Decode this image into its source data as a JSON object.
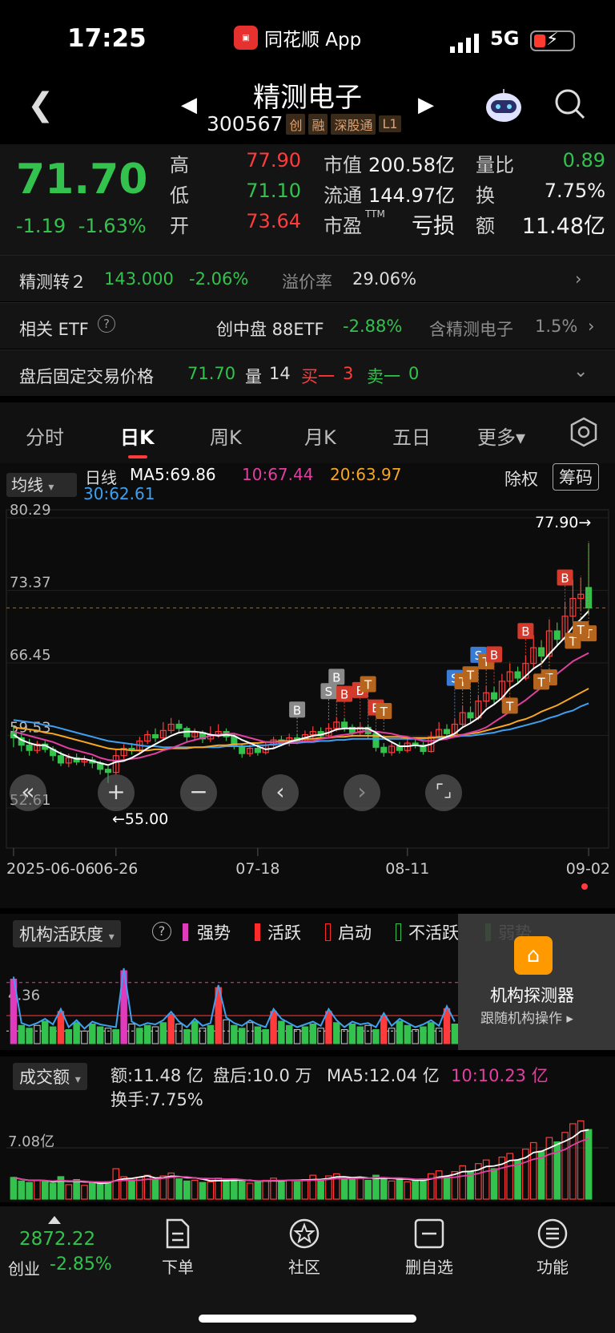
{
  "status": {
    "time": "17:25",
    "app": "同花顺 App",
    "network": "5G"
  },
  "header": {
    "name": "精测电子",
    "code": "300567",
    "tags": [
      "创",
      "融",
      "深股通",
      "L1"
    ]
  },
  "quote": {
    "price": "71.70",
    "change": "-1.19",
    "change_pct": "-1.63%",
    "high_label": "高",
    "high": "77.90",
    "low_label": "低",
    "low": "71.10",
    "open_label": "开",
    "open": "73.64",
    "mcap_label": "市值",
    "mcap": "200.58亿",
    "float_label": "流通",
    "float": "144.97亿",
    "pe_label": "市盈",
    "pe_sup": "TTM",
    "pe": "亏损",
    "vr_label": "量比",
    "vr": "0.89",
    "turn_label": "换",
    "turn": "7.75%",
    "amt_label": "额",
    "amt": "11.48亿"
  },
  "convertible": {
    "name": "精测转２",
    "price": "143.000",
    "pct": "-2.06%",
    "prem_label": "溢价率",
    "prem": "29.06%"
  },
  "etf": {
    "label": "相关 ETF",
    "name": "创中盘 88ETF",
    "pct": "-2.88%",
    "contain_label": "含精测电子",
    "weight": "1.5%"
  },
  "afterhours": {
    "label": "盘后固定交易价格",
    "price": "71.70",
    "vol_label": "量",
    "vol": "14",
    "buy_label": "买一",
    "buy": "3",
    "sell_label": "卖一",
    "sell": "0"
  },
  "tabs": [
    "分时",
    "日K",
    "周K",
    "月K",
    "五日",
    "更多▾"
  ],
  "ma_bar": {
    "select": "均线",
    "period": "日线",
    "ma5": "MA5:69.86",
    "ma10": "10:67.44",
    "ma20": "20:63.97",
    "ma30": "30:62.61",
    "adjust": "除权",
    "chip": "筹码"
  },
  "colors": {
    "up": "#ff3b3b",
    "down": "#33c24d",
    "ma5": "#ffffff",
    "ma10": "#e040a0",
    "ma20": "#f5a623",
    "ma30": "#3ea0f0"
  },
  "chart_data": {
    "type": "candlestick",
    "y_ticks": [
      "80.29",
      "73.37",
      "66.45",
      "59.53",
      "52.61"
    ],
    "ylim": [
      52.61,
      80.29
    ],
    "x_ticks": [
      "2025-06-06",
      "06-26",
      "07-18",
      "08-11",
      "09-02"
    ],
    "max_label": "77.90→",
    "min_label": "←55.00",
    "ref_line": 71.7,
    "candles": [
      [
        59.8,
        59.3,
        60.4,
        58.4
      ],
      [
        59.3,
        58.6,
        59.8,
        58.0
      ],
      [
        58.6,
        58.1,
        59.2,
        57.6
      ],
      [
        58.1,
        58.7,
        59.0,
        57.8
      ],
      [
        58.7,
        58.2,
        59.0,
        57.9
      ],
      [
        58.2,
        57.6,
        58.5,
        57.1
      ],
      [
        57.6,
        56.9,
        58.0,
        56.6
      ],
      [
        56.9,
        57.4,
        57.8,
        56.5
      ],
      [
        57.4,
        57.0,
        57.8,
        56.7
      ],
      [
        57.0,
        57.2,
        57.6,
        56.6
      ],
      [
        57.2,
        56.9,
        57.5,
        56.4
      ],
      [
        56.9,
        56.3,
        57.1,
        55.8
      ],
      [
        56.3,
        56.0,
        56.6,
        55.0
      ],
      [
        56.0,
        57.6,
        58.2,
        55.8
      ],
      [
        57.6,
        58.3,
        58.7,
        57.3
      ],
      [
        58.3,
        58.1,
        58.8,
        57.7
      ],
      [
        58.1,
        59.0,
        59.4,
        57.9
      ],
      [
        59.0,
        59.6,
        60.0,
        58.7
      ],
      [
        59.6,
        59.3,
        60.2,
        58.9
      ],
      [
        59.3,
        60.0,
        60.8,
        59.1
      ],
      [
        60.0,
        60.6,
        61.2,
        59.7
      ],
      [
        60.6,
        60.2,
        61.0,
        59.7
      ],
      [
        60.2,
        59.4,
        60.4,
        58.9
      ],
      [
        59.4,
        59.8,
        60.2,
        59.0
      ],
      [
        59.8,
        59.2,
        60.0,
        58.8
      ],
      [
        59.2,
        59.6,
        60.4,
        58.9
      ],
      [
        59.6,
        59.9,
        60.6,
        59.3
      ],
      [
        59.9,
        59.4,
        60.2,
        59.0
      ],
      [
        59.4,
        58.5,
        59.6,
        58.2
      ],
      [
        58.5,
        57.8,
        58.8,
        57.4
      ],
      [
        57.8,
        58.3,
        58.7,
        57.5
      ],
      [
        58.3,
        57.9,
        58.7,
        57.6
      ],
      [
        57.9,
        58.6,
        58.9,
        57.7
      ],
      [
        58.6,
        59.1,
        59.4,
        58.3
      ],
      [
        59.1,
        58.8,
        59.5,
        58.5
      ],
      [
        58.8,
        59.3,
        59.7,
        58.5
      ],
      [
        59.3,
        59.0,
        59.7,
        58.7
      ],
      [
        59.0,
        59.6,
        60.0,
        58.8
      ],
      [
        59.6,
        59.9,
        60.4,
        59.2
      ],
      [
        59.9,
        59.5,
        60.3,
        59.2
      ],
      [
        59.5,
        60.2,
        60.7,
        59.3
      ],
      [
        60.2,
        60.8,
        61.3,
        59.9
      ],
      [
        60.8,
        60.3,
        61.2,
        59.9
      ],
      [
        60.3,
        59.8,
        60.6,
        59.4
      ],
      [
        59.8,
        60.3,
        60.8,
        59.5
      ],
      [
        60.3,
        59.7,
        60.6,
        59.2
      ],
      [
        59.7,
        58.4,
        59.9,
        58.0
      ],
      [
        58.4,
        57.9,
        58.8,
        57.5
      ],
      [
        57.9,
        58.5,
        58.9,
        57.6
      ],
      [
        58.5,
        58.1,
        58.9,
        57.8
      ],
      [
        58.1,
        58.8,
        59.2,
        57.9
      ],
      [
        58.8,
        58.6,
        59.2,
        58.3
      ],
      [
        58.6,
        58.0,
        58.9,
        57.7
      ],
      [
        58.0,
        59.4,
        59.9,
        57.9
      ],
      [
        59.4,
        60.1,
        60.8,
        59.1
      ],
      [
        60.1,
        59.7,
        60.6,
        59.4
      ],
      [
        59.7,
        60.6,
        61.2,
        59.5
      ],
      [
        60.6,
        61.7,
        62.4,
        60.4
      ],
      [
        61.7,
        61.2,
        62.3,
        60.8
      ],
      [
        61.2,
        62.8,
        63.4,
        61.0
      ],
      [
        62.8,
        63.6,
        64.3,
        62.2
      ],
      [
        63.6,
        63.0,
        64.2,
        62.6
      ],
      [
        63.0,
        64.7,
        65.4,
        62.8
      ],
      [
        64.7,
        65.6,
        66.4,
        64.2
      ],
      [
        65.6,
        65.0,
        66.1,
        64.5
      ],
      [
        65.0,
        66.4,
        67.2,
        64.8
      ],
      [
        66.4,
        67.9,
        69.1,
        66.0
      ],
      [
        67.9,
        67.1,
        68.6,
        66.5
      ],
      [
        67.1,
        69.5,
        70.6,
        66.9
      ],
      [
        69.5,
        68.7,
        70.3,
        68.1
      ],
      [
        68.7,
        70.9,
        72.3,
        68.4
      ],
      [
        70.9,
        72.6,
        74.3,
        70.4
      ],
      [
        72.6,
        73.0,
        74.6,
        71.5
      ],
      [
        73.64,
        71.7,
        77.9,
        71.1
      ]
    ],
    "ma5": [
      59.6,
      59.1,
      58.8,
      58.6,
      58.6,
      58.2,
      57.8,
      57.5,
      57.3,
      57.3,
      57.1,
      56.9,
      56.7,
      57.0,
      57.1,
      57.4,
      57.8,
      58.3,
      58.7,
      59.1,
      59.5,
      59.8,
      59.9,
      59.9,
      59.8,
      59.6,
      59.5,
      59.6,
      59.5,
      59.1,
      58.8,
      58.5,
      58.2,
      58.3,
      58.6,
      58.9,
      59.1,
      59.3,
      59.5,
      59.6,
      59.8,
      60.1,
      60.2,
      60.2,
      60.2,
      60.2,
      59.8,
      59.3,
      58.9,
      58.5,
      58.5,
      58.6,
      58.5,
      58.7,
      59.1,
      59.4,
      59.7,
      60.3,
      60.7,
      61.2,
      62.0,
      62.5,
      63.1,
      64.0,
      64.5,
      65.2,
      65.9,
      66.4,
      67.3,
      68.1,
      68.9,
      69.9,
      70.6,
      71.4
    ],
    "ma10": [
      59.9,
      59.7,
      59.5,
      59.3,
      59.1,
      58.9,
      58.6,
      58.3,
      58.1,
      57.9,
      57.7,
      57.4,
      57.2,
      57.1,
      57.2,
      57.3,
      57.4,
      57.6,
      57.8,
      58.1,
      58.3,
      58.6,
      58.9,
      59.1,
      59.3,
      59.5,
      59.6,
      59.7,
      59.7,
      59.5,
      59.3,
      59.1,
      58.9,
      58.9,
      58.9,
      58.9,
      58.9,
      59.0,
      59.0,
      59.2,
      59.3,
      59.5,
      59.6,
      59.7,
      59.9,
      60.0,
      59.9,
      59.8,
      59.7,
      59.5,
      59.4,
      59.2,
      59.0,
      59.0,
      59.1,
      59.2,
      59.4,
      59.6,
      59.8,
      60.0,
      60.3,
      60.8,
      61.3,
      61.8,
      62.4,
      62.9,
      63.5,
      64.1,
      64.8,
      65.4,
      66.0,
      66.6,
      67.0,
      67.4
    ],
    "ma20": [
      60.3,
      60.2,
      60.1,
      60.0,
      59.8,
      59.7,
      59.5,
      59.3,
      59.1,
      58.9,
      58.7,
      58.5,
      58.3,
      58.2,
      58.2,
      58.1,
      58.1,
      58.1,
      58.2,
      58.2,
      58.3,
      58.3,
      58.3,
      58.4,
      58.4,
      58.5,
      58.6,
      58.6,
      58.7,
      58.7,
      58.8,
      58.8,
      58.9,
      58.9,
      59.0,
      59.0,
      59.1,
      59.2,
      59.2,
      59.3,
      59.3,
      59.4,
      59.4,
      59.5,
      59.5,
      59.5,
      59.5,
      59.4,
      59.4,
      59.4,
      59.3,
      59.3,
      59.3,
      59.3,
      59.4,
      59.4,
      59.5,
      59.6,
      59.7,
      59.8,
      60.0,
      60.2,
      60.4,
      60.6,
      60.9,
      61.1,
      61.4,
      61.8,
      62.1,
      62.4,
      62.8,
      63.2,
      63.6,
      64.0
    ],
    "ma30": [
      61.0,
      60.9,
      60.8,
      60.7,
      60.5,
      60.4,
      60.2,
      60.0,
      59.8,
      59.6,
      59.4,
      59.2,
      59.0,
      58.9,
      58.8,
      58.7,
      58.6,
      58.5,
      58.5,
      58.4,
      58.4,
      58.4,
      58.4,
      58.4,
      58.4,
      58.4,
      58.4,
      58.5,
      58.5,
      58.5,
      58.5,
      58.6,
      58.6,
      58.7,
      58.7,
      58.8,
      58.8,
      58.9,
      58.9,
      59.0,
      59.0,
      59.1,
      59.1,
      59.2,
      59.2,
      59.2,
      59.2,
      59.2,
      59.2,
      59.2,
      59.2,
      59.2,
      59.2,
      59.3,
      59.3,
      59.3,
      59.4,
      59.5,
      59.5,
      59.6,
      59.7,
      59.8,
      60.0,
      60.1,
      60.3,
      60.5,
      60.7,
      60.9,
      61.2,
      61.4,
      61.7,
      61.9,
      62.3,
      62.6
    ],
    "signals": [
      {
        "i": 36,
        "t": "B",
        "c": "gray"
      },
      {
        "i": 40,
        "t": "S",
        "c": "gray"
      },
      {
        "i": 41,
        "t": "B",
        "c": "gray"
      },
      {
        "i": 42,
        "t": "B",
        "c": "red"
      },
      {
        "i": 44,
        "t": "B",
        "c": "red"
      },
      {
        "i": 45,
        "t": "T",
        "c": "brown"
      },
      {
        "i": 46,
        "t": "B",
        "c": "red"
      },
      {
        "i": 47,
        "t": "T",
        "c": "brown"
      },
      {
        "i": 56,
        "t": "S",
        "c": "blue"
      },
      {
        "i": 57,
        "t": "T",
        "c": "brown"
      },
      {
        "i": 58,
        "t": "T",
        "c": "brown"
      },
      {
        "i": 59,
        "t": "S",
        "c": "blue"
      },
      {
        "i": 60,
        "t": "T",
        "c": "brown"
      },
      {
        "i": 61,
        "t": "B",
        "c": "red"
      },
      {
        "i": 63,
        "t": "T",
        "c": "brown"
      },
      {
        "i": 65,
        "t": "B",
        "c": "red"
      },
      {
        "i": 68,
        "t": "T",
        "c": "brown"
      },
      {
        "i": 67,
        "t": "T",
        "c": "brown"
      },
      {
        "i": 70,
        "t": "B",
        "c": "red"
      },
      {
        "i": 71,
        "t": "T",
        "c": "brown"
      },
      {
        "i": 73,
        "t": "T",
        "c": "brown"
      },
      {
        "i": 72,
        "t": "T",
        "c": "brown"
      }
    ],
    "activity": {
      "label": "4.36",
      "values": [
        4.6,
        1.3,
        1.1,
        1.3,
        1.6,
        1.2,
        2.3,
        1.0,
        1.5,
        0.9,
        1.4,
        1.2,
        1.1,
        1.0,
        5.2,
        1.4,
        1.1,
        1.3,
        1.2,
        1.5,
        2.1,
        1.4,
        1.0,
        1.6,
        1.1,
        1.3,
        4.0,
        1.7,
        1.3,
        1.1,
        1.5,
        1.2,
        1.0,
        2.3,
        1.6,
        1.3,
        1.0,
        1.2,
        1.4,
        1.1,
        2.3,
        1.5,
        1.0,
        1.4,
        1.2,
        1.3,
        1.0,
        2.0,
        1.1,
        1.6,
        1.3,
        1.0,
        1.2,
        1.5,
        1.1,
        2.5,
        1.4,
        1.2,
        1.0,
        1.3,
        1.6,
        1.1,
        1.2,
        1.5,
        1.0,
        1.3,
        1.1,
        2.3,
        1.4,
        1.2,
        1.0,
        1.3,
        1.1,
        1.2
      ]
    },
    "volume": {
      "label": "7.08亿",
      "values": [
        3.0,
        2.5,
        2.3,
        2.6,
        2.4,
        2.2,
        3.1,
        2.0,
        2.7,
        1.9,
        2.2,
        2.1,
        2.4,
        4.2,
        3.1,
        2.5,
        3.0,
        3.3,
        2.7,
        3.2,
        3.6,
        2.8,
        2.5,
        2.6,
        2.3,
        2.4,
        2.9,
        2.6,
        2.8,
        2.5,
        2.2,
        2.4,
        2.6,
        2.9,
        2.5,
        2.6,
        2.4,
        2.7,
        3.3,
        2.6,
        3.2,
        3.5,
        2.8,
        2.7,
        3.0,
        2.6,
        3.3,
        2.9,
        2.5,
        2.7,
        2.4,
        2.6,
        2.8,
        3.5,
        3.9,
        3.1,
        3.8,
        4.6,
        3.8,
        4.9,
        5.4,
        4.2,
        5.8,
        6.3,
        5.4,
        6.9,
        7.8,
        6.6,
        8.5,
        7.9,
        9.2,
        10.4,
        10.8,
        9.6
      ]
    }
  },
  "activity_bar": {
    "select": "机构活跃度",
    "help": "?",
    "legend": [
      "强势",
      "活跃",
      "启动",
      "不活跃",
      "弱势"
    ],
    "panel_title": "机构探测器",
    "panel_sub": "跟随机构操作 ▸"
  },
  "volume_bar": {
    "select": "成交额",
    "amt": "额:11.48 亿",
    "after": "盘后:10.0 万",
    "ma5": "MA5:12.04 亿",
    "ma10": "10:10.23 亿",
    "turn": "换手:7.75%"
  },
  "bottom": {
    "index_value": "2872.22",
    "index_name": "创业",
    "index_pct": "-2.85%",
    "nav": [
      "下单",
      "社区",
      "删自选",
      "功能"
    ]
  }
}
